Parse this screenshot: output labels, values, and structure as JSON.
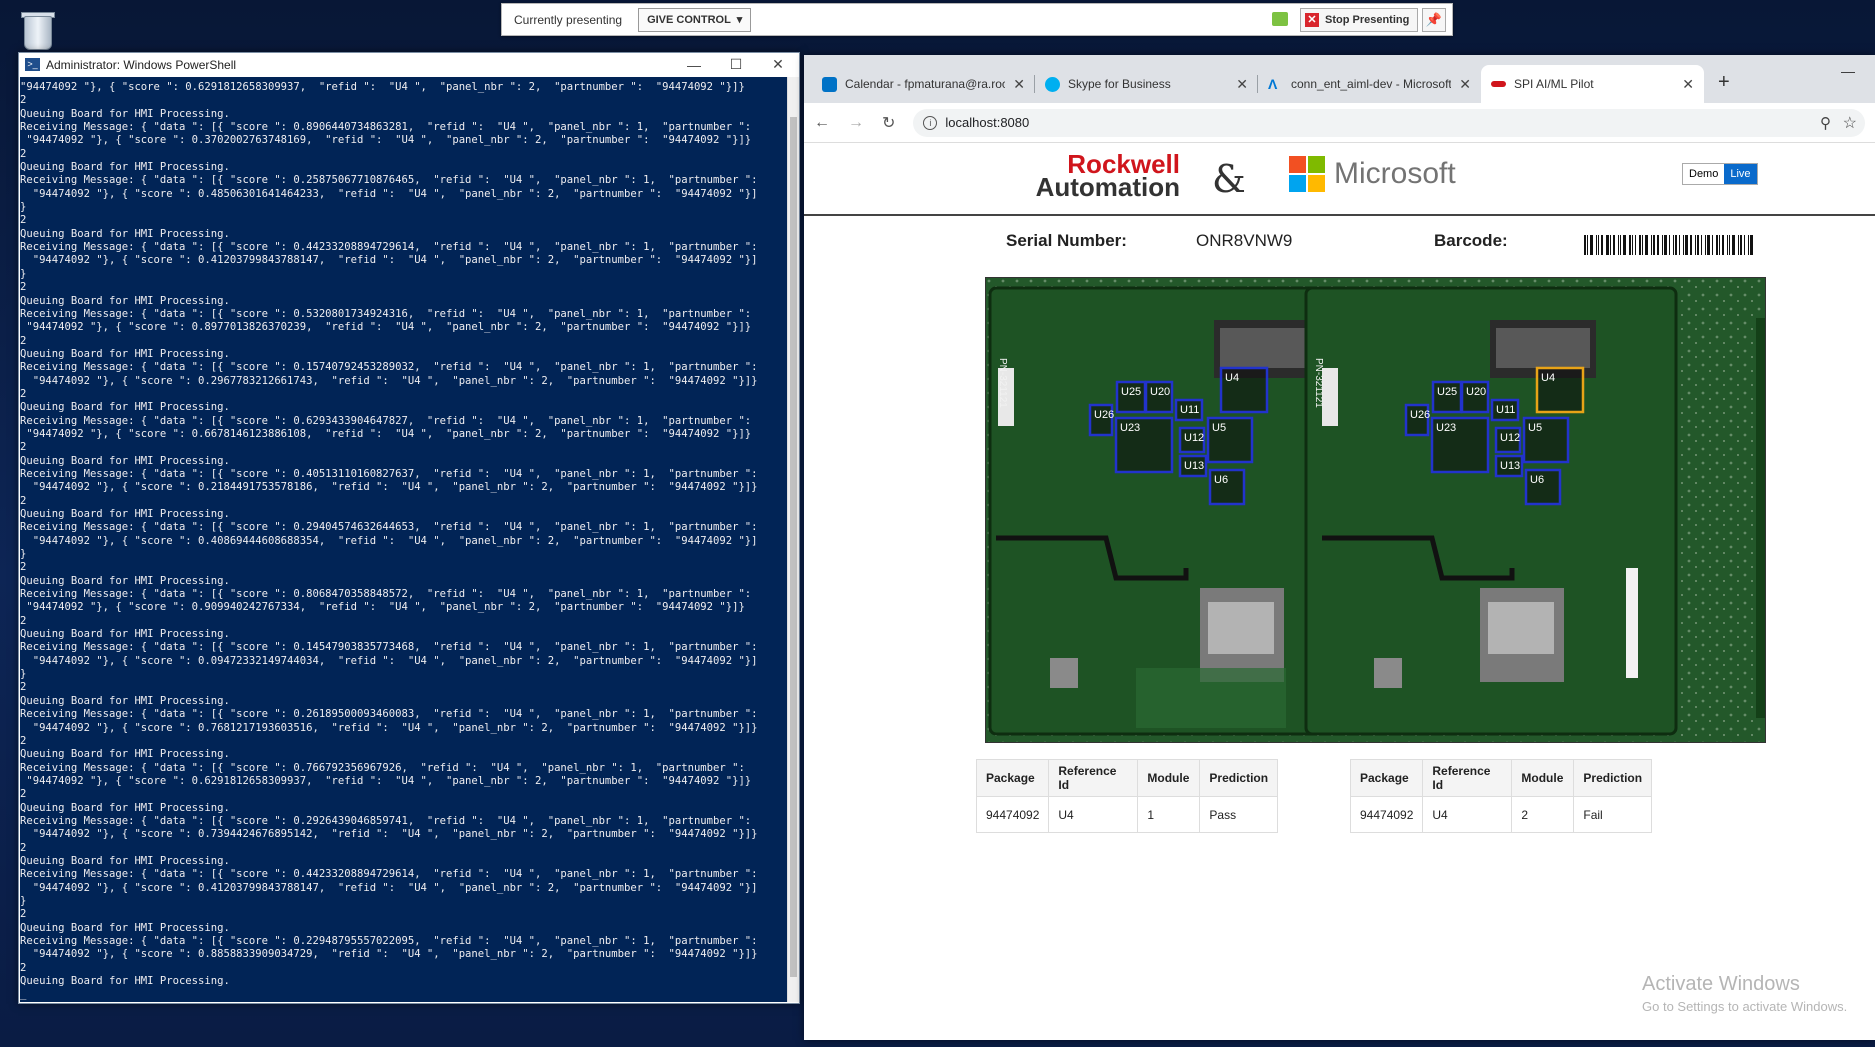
{
  "desktop": {
    "recycle_bin_icon": "recycle-bin-icon"
  },
  "presenting_bar": {
    "status_label": "Currently presenting",
    "give_control_label": "GIVE CONTROL",
    "stop_label": "Stop Presenting"
  },
  "powershell": {
    "title": "Administrator: Windows PowerShell",
    "lines": [
      "\"94474092 \"}, { \"score \": 0.6291812658309937,  \"refid \":  \"U4 \",  \"panel_nbr \": 2,  \"partnumber \":  \"94474092 \"}]}",
      "2",
      "Queuing Board for HMI Processing.",
      "Receiving Message: { \"data \": [{ \"score \": 0.8906440734863281,  \"refid \":  \"U4 \",  \"panel_nbr \": 1,  \"partnumber \":",
      " \"94474092 \"}, { \"score \": 0.3702002763748169,  \"refid \":  \"U4 \",  \"panel_nbr \": 2,  \"partnumber \":  \"94474092 \"}]}",
      "2",
      "Queuing Board for HMI Processing.",
      "Receiving Message: { \"data \": [{ \"score \": 0.25875067710876465,  \"refid \":  \"U4 \",  \"panel_nbr \": 1,  \"partnumber \":",
      "  \"94474092 \"}, { \"score \": 0.48506301641464233,  \"refid \":  \"U4 \",  \"panel_nbr \": 2,  \"partnumber \":  \"94474092 \"}]",
      "}",
      "2",
      "Queuing Board for HMI Processing.",
      "Receiving Message: { \"data \": [{ \"score \": 0.44233208894729614,  \"refid \":  \"U4 \",  \"panel_nbr \": 1,  \"partnumber \":",
      "  \"94474092 \"}, { \"score \": 0.41203799843788147,  \"refid \":  \"U4 \",  \"panel_nbr \": 2,  \"partnumber \":  \"94474092 \"}]",
      "}",
      "2",
      "Queuing Board for HMI Processing.",
      "Receiving Message: { \"data \": [{ \"score \": 0.5320801734924316,  \"refid \":  \"U4 \",  \"panel_nbr \": 1,  \"partnumber \":",
      " \"94474092 \"}, { \"score \": 0.8977013826370239,  \"refid \":  \"U4 \",  \"panel_nbr \": 2,  \"partnumber \":  \"94474092 \"}]}",
      "2",
      "Queuing Board for HMI Processing.",
      "Receiving Message: { \"data \": [{ \"score \": 0.15740792453289032,  \"refid \":  \"U4 \",  \"panel_nbr \": 1,  \"partnumber \":",
      "  \"94474092 \"}, { \"score \": 0.2967783212661743,  \"refid \":  \"U4 \",  \"panel_nbr \": 2,  \"partnumber \":  \"94474092 \"}]}",
      "2",
      "Queuing Board for HMI Processing.",
      "Receiving Message: { \"data \": [{ \"score \": 0.6293433904647827,  \"refid \":  \"U4 \",  \"panel_nbr \": 1,  \"partnumber \":",
      " \"94474092 \"}, { \"score \": 0.6678146123886108,  \"refid \":  \"U4 \",  \"panel_nbr \": 2,  \"partnumber \":  \"94474092 \"}]}",
      "2",
      "Queuing Board for HMI Processing.",
      "Receiving Message: { \"data \": [{ \"score \": 0.40513110160827637,  \"refid \":  \"U4 \",  \"panel_nbr \": 1,  \"partnumber \":",
      "  \"94474092 \"}, { \"score \": 0.2184491753578186,  \"refid \":  \"U4 \",  \"panel_nbr \": 2,  \"partnumber \":  \"94474092 \"}]}",
      "2",
      "Queuing Board for HMI Processing.",
      "Receiving Message: { \"data \": [{ \"score \": 0.29404574632644653,  \"refid \":  \"U4 \",  \"panel_nbr \": 1,  \"partnumber \":",
      "  \"94474092 \"}, { \"score \": 0.40869444608688354,  \"refid \":  \"U4 \",  \"panel_nbr \": 2,  \"partnumber \":  \"94474092 \"}]",
      "}",
      "2",
      "Queuing Board for HMI Processing.",
      "Receiving Message: { \"data \": [{ \"score \": 0.8068470358848572,  \"refid \":  \"U4 \",  \"panel_nbr \": 1,  \"partnumber \":",
      " \"94474092 \"}, { \"score \": 0.909940242767334,  \"refid \":  \"U4 \",  \"panel_nbr \": 2,  \"partnumber \":  \"94474092 \"}]}",
      "2",
      "Queuing Board for HMI Processing.",
      "Receiving Message: { \"data \": [{ \"score \": 0.14547903835773468,  \"refid \":  \"U4 \",  \"panel_nbr \": 1,  \"partnumber \":",
      "  \"94474092 \"}, { \"score \": 0.09472332149744034,  \"refid \":  \"U4 \",  \"panel_nbr \": 2,  \"partnumber \":  \"94474092 \"}]",
      "}",
      "2",
      "Queuing Board for HMI Processing.",
      "Receiving Message: { \"data \": [{ \"score \": 0.26189500093460083,  \"refid \":  \"U4 \",  \"panel_nbr \": 1,  \"partnumber \":",
      "  \"94474092 \"}, { \"score \": 0.7681217193603516,  \"refid \":  \"U4 \",  \"panel_nbr \": 2,  \"partnumber \":  \"94474092 \"}]}",
      "2",
      "Queuing Board for HMI Processing.",
      "Receiving Message: { \"data \": [{ \"score \": 0.766792356967926,  \"refid \":  \"U4 \",  \"panel_nbr \": 1,  \"partnumber \":",
      " \"94474092 \"}, { \"score \": 0.6291812658309937,  \"refid \":  \"U4 \",  \"panel_nbr \": 2,  \"partnumber \":  \"94474092 \"}]}",
      "2",
      "Queuing Board for HMI Processing.",
      "Receiving Message: { \"data \": [{ \"score \": 0.2926439046859741,  \"refid \":  \"U4 \",  \"panel_nbr \": 1,  \"partnumber \":",
      "  \"94474092 \"}, { \"score \": 0.7394424676895142,  \"refid \":  \"U4 \",  \"panel_nbr \": 2,  \"partnumber \":  \"94474092 \"}]}",
      "2",
      "Queuing Board for HMI Processing.",
      "Receiving Message: { \"data \": [{ \"score \": 0.44233208894729614,  \"refid \":  \"U4 \",  \"panel_nbr \": 1,  \"partnumber \":",
      "  \"94474092 \"}, { \"score \": 0.41203799843788147,  \"refid \":  \"U4 \",  \"panel_nbr \": 2,  \"partnumber \":  \"94474092 \"}]",
      "}",
      "2",
      "Queuing Board for HMI Processing.",
      "Receiving Message: { \"data \": [{ \"score \": 0.22948795557022095,  \"refid \":  \"U4 \",  \"panel_nbr \": 1,  \"partnumber \":",
      "  \"94474092 \"}, { \"score \": 0.8858833909034729,  \"refid \":  \"U4 \",  \"panel_nbr \": 2,  \"partnumber \":  \"94474092 \"}]}",
      "2",
      "Queuing Board for HMI Processing.",
      "_"
    ]
  },
  "browser": {
    "tabs": [
      {
        "label": "Calendar - fpmaturana@ra.rockw",
        "icon": "outlook-icon",
        "color": "#0072c6"
      },
      {
        "label": "Skype for Business",
        "icon": "skype-icon",
        "color": "#00aff0"
      },
      {
        "label": "conn_ent_aiml-dev - Microsoft A",
        "icon": "azure-icon",
        "color": "#0078d4"
      },
      {
        "label": "SPI AI/ML Pilot",
        "icon": "rockwell-icon",
        "color": "#d0151c"
      }
    ],
    "url": "localhost:8080"
  },
  "app": {
    "brand1_line1": "Rockwell",
    "brand1_line2": "Automation",
    "ampersand": "&",
    "brand2": "Microsoft",
    "mode_demo": "Demo",
    "mode_live": "Live",
    "serial_label": "Serial Number:",
    "serial_value": "ONR8VNW9",
    "barcode_label": "Barcode:",
    "board_labels": [
      "U25",
      "U20",
      "U4",
      "U26",
      "U11",
      "U23",
      "U5",
      "U12",
      "U13",
      "U6"
    ],
    "board_silkscreen": "PN-321121",
    "table_headers": [
      "Package",
      "Reference Id",
      "Module",
      "Prediction"
    ],
    "results": [
      {
        "package": "94474092",
        "refid": "U4",
        "module": "1",
        "prediction": "Pass"
      },
      {
        "package": "94474092",
        "refid": "U4",
        "module": "2",
        "prediction": "Fail"
      }
    ],
    "colors": {
      "pass_box": "#2233cc",
      "fail_box": "#e8a317",
      "brand_red": "#d0151c",
      "live_blue": "#0a6acb"
    }
  },
  "watermark": {
    "line1": "Activate Windows",
    "line2": "Go to Settings to activate Windows."
  }
}
